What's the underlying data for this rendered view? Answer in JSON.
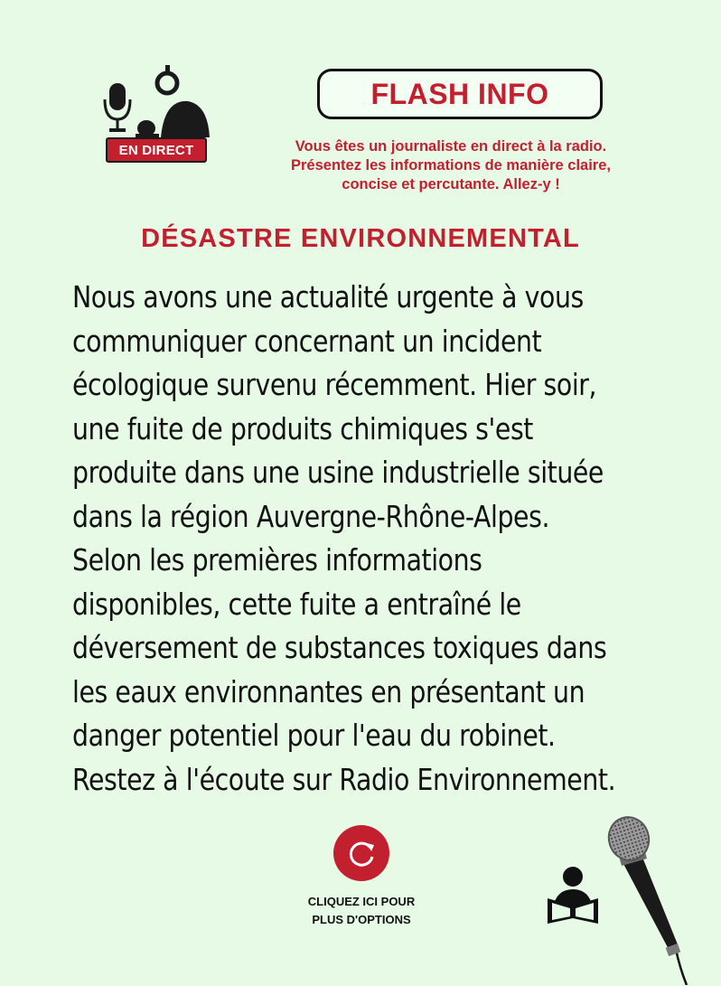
{
  "header": {
    "live_badge": "EN DIRECT",
    "flash_label": "FLASH INFO",
    "instructions": [
      "Vous êtes un journaliste en direct à la radio.",
      "Présentez les informations de manière claire,",
      "concise et percutante. Allez-y !"
    ]
  },
  "headline": "DÉSASTRE ENVIRONNEMENTAL",
  "body_lines": [
    "Nous avons une actualité urgente à vous",
    "communiquer concernant un incident",
    "écologique survenu récemment. Hier soir,",
    "une fuite de produits chimiques s'est",
    "produite dans une usine industrielle située",
    "dans la région Auvergne-Rhône-Alpes.",
    "Selon les premières informations",
    "disponibles, cette fuite a entraîné le",
    "déversement de substances toxiques dans",
    "les eaux environnantes en présentant un",
    "danger potentiel pour l'eau du robinet.",
    "Restez à l'écoute sur Radio Environnement."
  ],
  "options": {
    "label_line1": "CLIQUEZ ICI POUR",
    "label_line2": "PLUS D'OPTIONS"
  },
  "colors": {
    "accent": "#c3202f",
    "background": "#e6fae6",
    "text": "#111111"
  },
  "icons": [
    "journalist-icon",
    "refresh-icon",
    "reader-icon",
    "microphone-icon"
  ]
}
